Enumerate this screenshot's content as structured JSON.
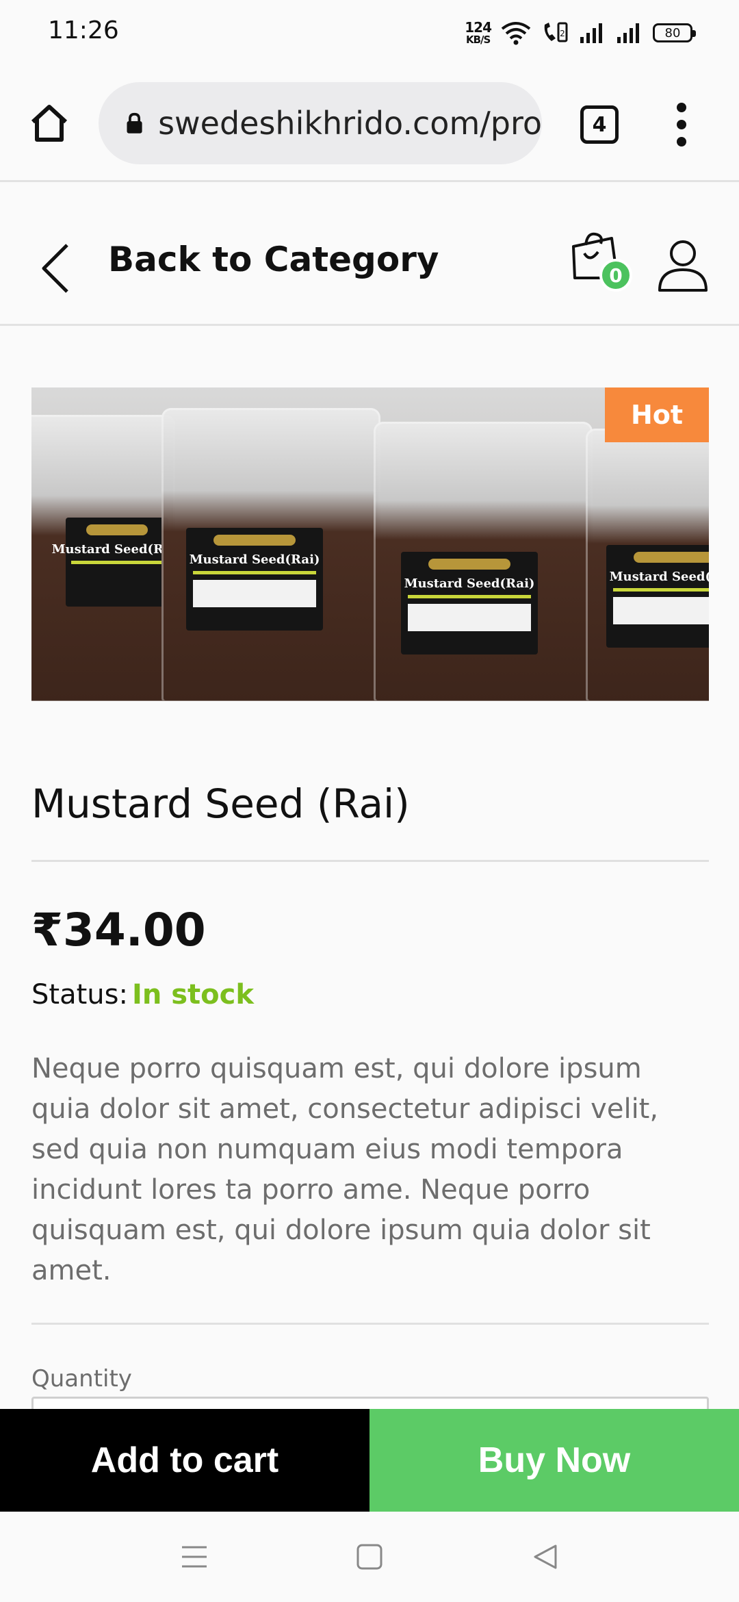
{
  "status_bar": {
    "time": "11:26",
    "net_speed_value": "124",
    "net_speed_unit": "KB/S",
    "battery": "80",
    "icons": [
      "wifi-icon",
      "volte-call-icon",
      "signal-icon",
      "signal-icon"
    ]
  },
  "browser": {
    "url": "swedeshikhrido.com/pro",
    "tab_count": "4",
    "icons": [
      "home-icon",
      "lock-icon",
      "more-vert-icon"
    ]
  },
  "header": {
    "back_label": "Back to Category",
    "cart_count": "0",
    "icons": [
      "chevron-left-icon",
      "shopping-bag-icon",
      "user-icon"
    ]
  },
  "product": {
    "image_alt": "Mustard Seed (Rai) packets",
    "pack_label": "Mustard Seed(Rai)",
    "badge": "Hot",
    "title": "Mustard Seed (Rai)",
    "price": "₹34.00",
    "status_label": "Status:",
    "status_value": "In stock",
    "description": "Neque porro quisquam est, qui dolore ipsum quia dolor sit amet, consectetur adipisci velit, sed quia non numquam eius modi tempora incidunt lores ta porro ame. Neque porro quisquam est, qui dolore ipsum quia dolor sit amet.",
    "quantity_label": "Quantity"
  },
  "actions": {
    "add_to_cart": "Add to cart",
    "buy_now": "Buy Now"
  },
  "colors": {
    "accent_green": "#5ccb66",
    "in_stock": "#7cbf1e",
    "hot_badge": "#f7893c",
    "cart_badge": "#4cc25e"
  },
  "nav_bar": {
    "icons": [
      "menu-icon",
      "home-square-icon",
      "back-triangle-icon"
    ]
  }
}
